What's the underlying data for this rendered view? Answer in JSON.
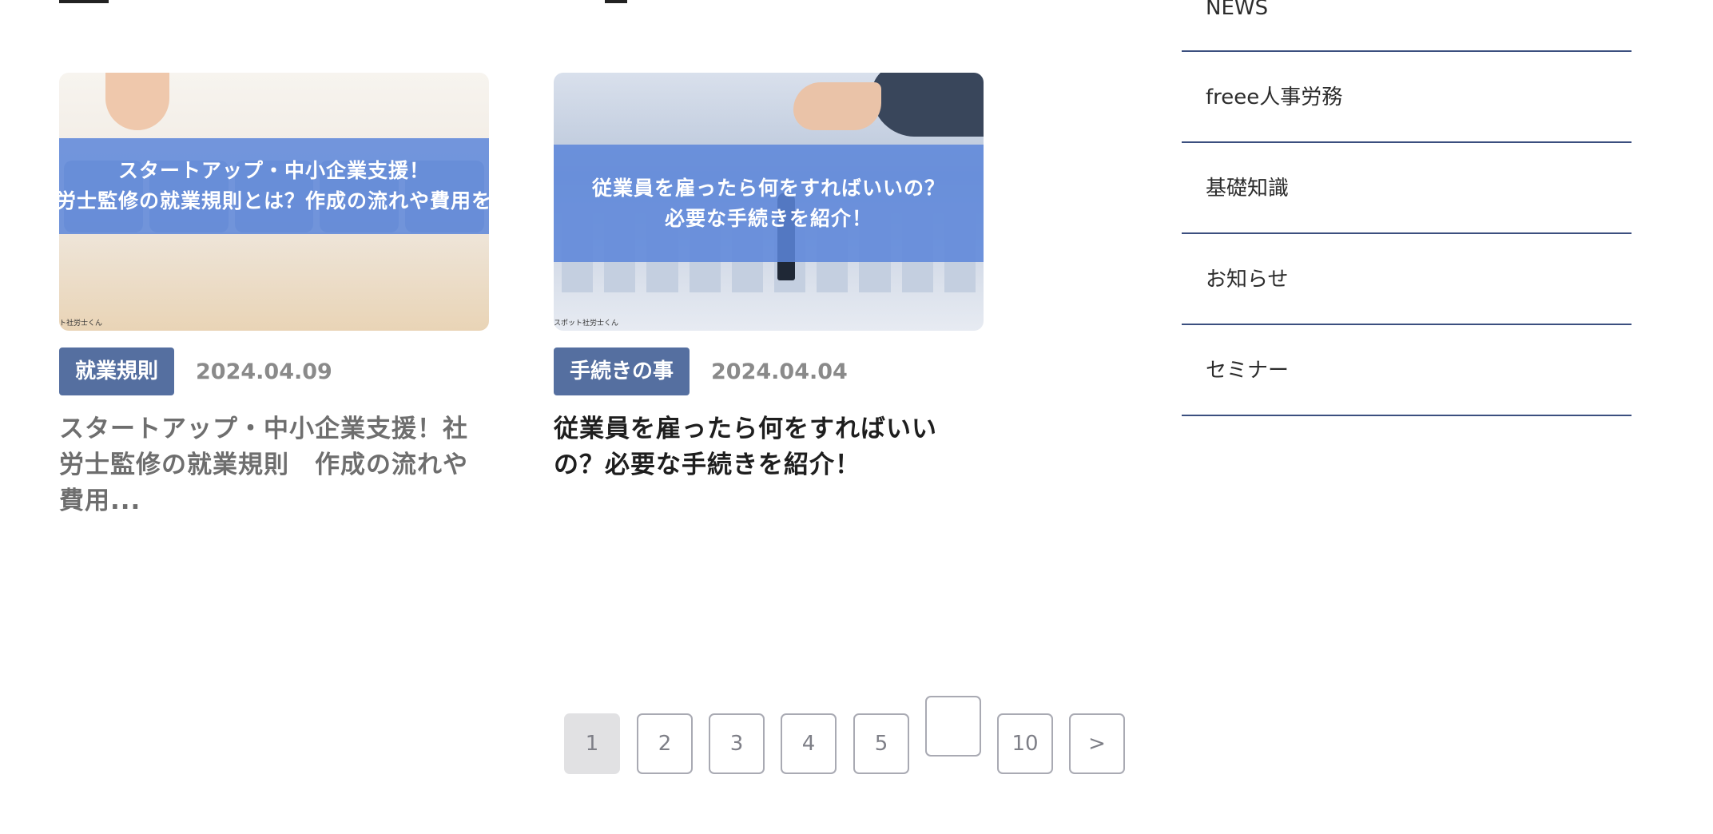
{
  "articles": [
    {
      "thumbnail_text": [
        "スタートアップ・中小企業支援！",
        "社労士監修の就業規則とは？作成の流れや費用を解"
      ],
      "thumbnail_credit": "ト社労士くん",
      "tag": "就業規則",
      "date": "2024.04.09",
      "title": "スタートアップ・中小企業支援！社労士監修の就業規則　作成の流れや費用..."
    },
    {
      "thumbnail_text": [
        "従業員を雇ったら何をすればいいの？",
        "必要な手続きを紹介！"
      ],
      "thumbnail_credit": "スポット社労士くん",
      "tag": "手続きの事",
      "date": "2024.04.04",
      "title": "従業員を雇ったら何をすればいいの？必要な手続きを紹介！"
    }
  ],
  "sidebar": {
    "items": [
      "NEWS",
      "freee人事労務",
      "基礎知識",
      "お知らせ",
      "セミナー"
    ]
  },
  "pagination": {
    "pages": [
      "1",
      "2",
      "3",
      "4",
      "5",
      "",
      "10"
    ],
    "current": "1",
    "next": ">"
  },
  "colors": {
    "tag_background": "#556fa0",
    "sidebar_divider": "#3b4f7f",
    "thumbnail_band": "#5c86da",
    "active_page": "#e1e1e3"
  }
}
